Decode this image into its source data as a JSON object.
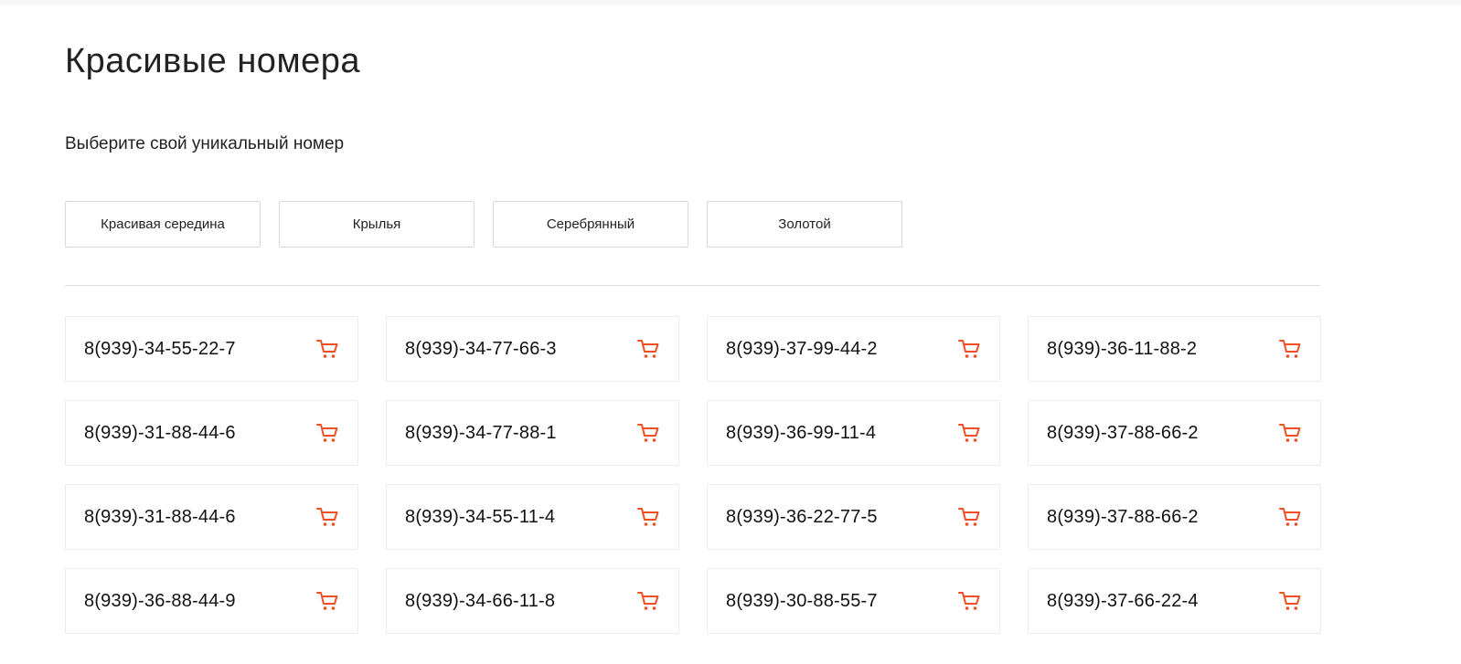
{
  "page": {
    "title": "Красивые номера",
    "subtitle": "Выберите свой уникальный номер",
    "accent_color": "#f04e23"
  },
  "filters": [
    {
      "label": "Красивая середина"
    },
    {
      "label": "Крылья"
    },
    {
      "label": "Серебрянный"
    },
    {
      "label": "Золотой"
    }
  ],
  "numbers": [
    {
      "number": "8(939)-34-55-22-7",
      "icon": "cart-icon"
    },
    {
      "number": "8(939)-34-77-66-3",
      "icon": "cart-icon"
    },
    {
      "number": "8(939)-37-99-44-2",
      "icon": "cart-icon"
    },
    {
      "number": "8(939)-36-11-88-2",
      "icon": "cart-icon"
    },
    {
      "number": "8(939)-31-88-44-6",
      "icon": "cart-icon"
    },
    {
      "number": "8(939)-34-77-88-1",
      "icon": "cart-icon"
    },
    {
      "number": "8(939)-36-99-11-4",
      "icon": "cart-icon"
    },
    {
      "number": "8(939)-37-88-66-2",
      "icon": "cart-icon"
    },
    {
      "number": "8(939)-31-88-44-6",
      "icon": "cart-icon"
    },
    {
      "number": "8(939)-34-55-11-4",
      "icon": "cart-icon"
    },
    {
      "number": "8(939)-36-22-77-5",
      "icon": "cart-icon"
    },
    {
      "number": "8(939)-37-88-66-2",
      "icon": "cart-icon"
    },
    {
      "number": "8(939)-36-88-44-9",
      "icon": "cart-icon"
    },
    {
      "number": "8(939)-34-66-11-8",
      "icon": "cart-icon"
    },
    {
      "number": "8(939)-30-88-55-7",
      "icon": "cart-icon"
    },
    {
      "number": "8(939)-37-66-22-4",
      "icon": "cart-icon"
    }
  ]
}
